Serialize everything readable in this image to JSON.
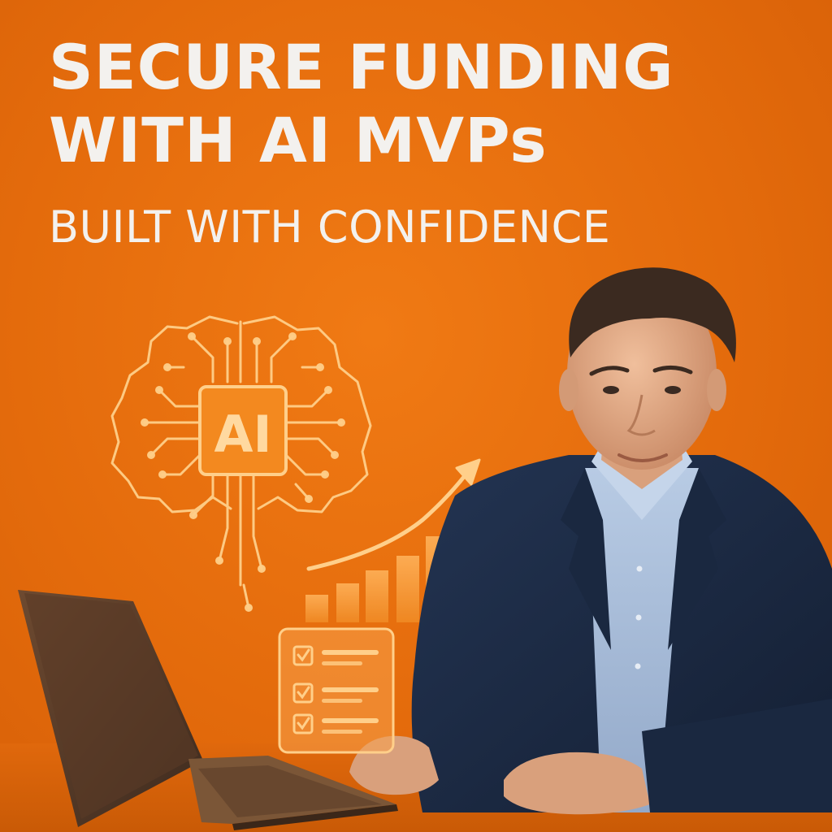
{
  "headline": {
    "line1": "SECURE FUNDING",
    "line2": "WITH AI MVPs",
    "line3": "BUILT WITH CONFIDENCE"
  },
  "brain_chip": {
    "label": "AI",
    "icon": "brain-circuit-icon"
  },
  "growth_chart": {
    "icon": "bar-chart-icon",
    "trend": "up"
  },
  "checklist": {
    "icon": "checklist-icon",
    "items_checked": 3
  },
  "colors": {
    "background": "#e8700f",
    "headline_text": "#f3f1ee",
    "accent_glow": "#ffcf8a",
    "suit": "#1c2b44",
    "shirt": "#a9bedb"
  }
}
